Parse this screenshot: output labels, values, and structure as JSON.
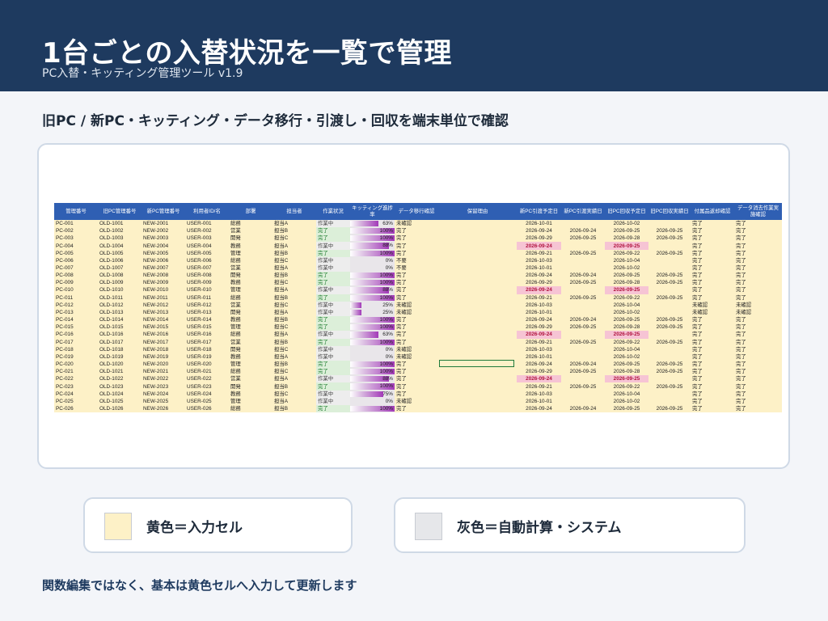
{
  "header": {
    "title": "1台ごとの入替状況を一覧で管理",
    "subtitle": "PC入替・キッティング管理ツール v1.9"
  },
  "section_title": "旧PC / 新PC・キッティング・データ移行・引渡し・回収を端末単位で確認",
  "colors": {
    "header_bg": "#1e3a5f",
    "grid_header": "#2f5fb3",
    "input_cell": "#fdf1c7",
    "auto_cell": "#e6e7ea",
    "overdue_cell": "#f6c4d4",
    "progress_bar": "#a23ab8"
  },
  "sheet": {
    "columns": [
      "管理番号",
      "旧PC管理番号",
      "新PC管理番号",
      "利用者ID/名",
      "部署",
      "担当者",
      "作業状況",
      "キッティング進捗率",
      "データ移行確認",
      "保留理由",
      "新PC引渡予定日",
      "新PC引渡実績日",
      "旧PC回収予定日",
      "旧PC回収実績日",
      "付属品返却確認",
      "データ消去作業実施確認"
    ],
    "rows": [
      {
        "id": "PC-001",
        "old": "OLD-1001",
        "new": "NEW-2001",
        "user": "USER-001",
        "dept": "総務",
        "owner": "担当A",
        "status": "作業中",
        "pct_label": "63%",
        "pct": 0.63,
        "migration": "未確認",
        "hold": "",
        "deliv_plan": "2026-10-01",
        "deliv_act": "",
        "coll_plan": "2026-10-02",
        "coll_act": "",
        "acc": "完了",
        "erase": "完了",
        "overdue": false
      },
      {
        "id": "PC-002",
        "old": "OLD-1002",
        "new": "NEW-2002",
        "user": "USER-002",
        "dept": "営業",
        "owner": "担当B",
        "status": "完了",
        "pct_label": "100%",
        "pct": 1.0,
        "migration": "完了",
        "hold": "",
        "deliv_plan": "2026-09-24",
        "deliv_act": "2026-09-24",
        "coll_plan": "2026-09-25",
        "coll_act": "2026-09-25",
        "acc": "完了",
        "erase": "完了",
        "overdue": false
      },
      {
        "id": "PC-003",
        "old": "OLD-1003",
        "new": "NEW-2003",
        "user": "USER-003",
        "dept": "開発",
        "owner": "担当C",
        "status": "完了",
        "pct_label": "100%",
        "pct": 1.0,
        "migration": "完了",
        "hold": "",
        "deliv_plan": "2026-09-29",
        "deliv_act": "2026-09-25",
        "coll_plan": "2026-09-28",
        "coll_act": "2026-09-25",
        "acc": "完了",
        "erase": "完了",
        "overdue": false
      },
      {
        "id": "PC-004",
        "old": "OLD-1004",
        "new": "NEW-2004",
        "user": "USER-004",
        "dept": "教務",
        "owner": "担当A",
        "status": "作業中",
        "pct_label": "88%",
        "pct": 0.88,
        "migration": "完了",
        "hold": "",
        "deliv_plan": "2026-09-24",
        "deliv_act": "",
        "coll_plan": "2026-09-25",
        "coll_act": "",
        "acc": "完了",
        "erase": "完了",
        "overdue": true
      },
      {
        "id": "PC-005",
        "old": "OLD-1005",
        "new": "NEW-2005",
        "user": "USER-005",
        "dept": "管理",
        "owner": "担当B",
        "status": "完了",
        "pct_label": "100%",
        "pct": 1.0,
        "migration": "完了",
        "hold": "",
        "deliv_plan": "2026-09-21",
        "deliv_act": "2026-09-25",
        "coll_plan": "2026-09-22",
        "coll_act": "2026-09-25",
        "acc": "完了",
        "erase": "完了",
        "overdue": false
      },
      {
        "id": "PC-006",
        "old": "OLD-1006",
        "new": "NEW-2006",
        "user": "USER-006",
        "dept": "総務",
        "owner": "担当C",
        "status": "作業中",
        "pct_label": "0%",
        "pct": 0.0,
        "migration": "不要",
        "hold": "",
        "deliv_plan": "2026-10-03",
        "deliv_act": "",
        "coll_plan": "2026-10-04",
        "coll_act": "",
        "acc": "完了",
        "erase": "完了",
        "overdue": false
      },
      {
        "id": "PC-007",
        "old": "OLD-1007",
        "new": "NEW-2007",
        "user": "USER-007",
        "dept": "営業",
        "owner": "担当A",
        "status": "作業中",
        "pct_label": "0%",
        "pct": 0.0,
        "migration": "不要",
        "hold": "",
        "deliv_plan": "2026-10-01",
        "deliv_act": "",
        "coll_plan": "2026-10-02",
        "coll_act": "",
        "acc": "完了",
        "erase": "完了",
        "overdue": false
      },
      {
        "id": "PC-008",
        "old": "OLD-1008",
        "new": "NEW-2008",
        "user": "USER-008",
        "dept": "開発",
        "owner": "担当B",
        "status": "完了",
        "pct_label": "100%",
        "pct": 1.0,
        "migration": "完了",
        "hold": "",
        "deliv_plan": "2026-09-24",
        "deliv_act": "2026-09-24",
        "coll_plan": "2026-09-25",
        "coll_act": "2026-09-25",
        "acc": "完了",
        "erase": "完了",
        "overdue": false
      },
      {
        "id": "PC-009",
        "old": "OLD-1009",
        "new": "NEW-2009",
        "user": "USER-009",
        "dept": "教務",
        "owner": "担当C",
        "status": "完了",
        "pct_label": "100%",
        "pct": 1.0,
        "migration": "完了",
        "hold": "",
        "deliv_plan": "2026-09-29",
        "deliv_act": "2026-09-25",
        "coll_plan": "2026-09-28",
        "coll_act": "2026-09-25",
        "acc": "完了",
        "erase": "完了",
        "overdue": false
      },
      {
        "id": "PC-010",
        "old": "OLD-1010",
        "new": "NEW-2010",
        "user": "USER-010",
        "dept": "管理",
        "owner": "担当A",
        "status": "作業中",
        "pct_label": "88%",
        "pct": 0.88,
        "migration": "完了",
        "hold": "",
        "deliv_plan": "2026-09-24",
        "deliv_act": "",
        "coll_plan": "2026-09-25",
        "coll_act": "",
        "acc": "完了",
        "erase": "完了",
        "overdue": true
      },
      {
        "id": "PC-011",
        "old": "OLD-1011",
        "new": "NEW-2011",
        "user": "USER-011",
        "dept": "総務",
        "owner": "担当B",
        "status": "完了",
        "pct_label": "100%",
        "pct": 1.0,
        "migration": "完了",
        "hold": "",
        "deliv_plan": "2026-09-21",
        "deliv_act": "2026-09-25",
        "coll_plan": "2026-09-22",
        "coll_act": "2026-09-25",
        "acc": "完了",
        "erase": "完了",
        "overdue": false
      },
      {
        "id": "PC-012",
        "old": "OLD-1012",
        "new": "NEW-2012",
        "user": "USER-012",
        "dept": "営業",
        "owner": "担当C",
        "status": "作業中",
        "pct_label": "25%",
        "pct": 0.25,
        "migration": "未確認",
        "hold": "",
        "deliv_plan": "2026-10-03",
        "deliv_act": "",
        "coll_plan": "2026-10-04",
        "coll_act": "",
        "acc": "未確認",
        "erase": "未確認",
        "overdue": false
      },
      {
        "id": "PC-013",
        "old": "OLD-1013",
        "new": "NEW-2013",
        "user": "USER-013",
        "dept": "開発",
        "owner": "担当A",
        "status": "作業中",
        "pct_label": "25%",
        "pct": 0.25,
        "migration": "未確認",
        "hold": "",
        "deliv_plan": "2026-10-01",
        "deliv_act": "",
        "coll_plan": "2026-10-02",
        "coll_act": "",
        "acc": "未確認",
        "erase": "未確認",
        "overdue": false
      },
      {
        "id": "PC-014",
        "old": "OLD-1014",
        "new": "NEW-2014",
        "user": "USER-014",
        "dept": "教務",
        "owner": "担当B",
        "status": "完了",
        "pct_label": "100%",
        "pct": 1.0,
        "migration": "完了",
        "hold": "",
        "deliv_plan": "2026-09-24",
        "deliv_act": "2026-09-24",
        "coll_plan": "2026-09-25",
        "coll_act": "2026-09-25",
        "acc": "完了",
        "erase": "完了",
        "overdue": false
      },
      {
        "id": "PC-015",
        "old": "OLD-1015",
        "new": "NEW-2015",
        "user": "USER-015",
        "dept": "管理",
        "owner": "担当C",
        "status": "完了",
        "pct_label": "100%",
        "pct": 1.0,
        "migration": "完了",
        "hold": "",
        "deliv_plan": "2026-09-29",
        "deliv_act": "2026-09-25",
        "coll_plan": "2026-09-28",
        "coll_act": "2026-09-25",
        "acc": "完了",
        "erase": "完了",
        "overdue": false
      },
      {
        "id": "PC-016",
        "old": "OLD-1016",
        "new": "NEW-2016",
        "user": "USER-016",
        "dept": "総務",
        "owner": "担当A",
        "status": "作業中",
        "pct_label": "63%",
        "pct": 0.63,
        "migration": "完了",
        "hold": "",
        "deliv_plan": "2026-09-24",
        "deliv_act": "",
        "coll_plan": "2026-09-25",
        "coll_act": "",
        "acc": "完了",
        "erase": "完了",
        "overdue": true
      },
      {
        "id": "PC-017",
        "old": "OLD-1017",
        "new": "NEW-2017",
        "user": "USER-017",
        "dept": "営業",
        "owner": "担当B",
        "status": "完了",
        "pct_label": "100%",
        "pct": 1.0,
        "migration": "完了",
        "hold": "",
        "deliv_plan": "2026-09-21",
        "deliv_act": "2026-09-25",
        "coll_plan": "2026-09-22",
        "coll_act": "2026-09-25",
        "acc": "完了",
        "erase": "完了",
        "overdue": false
      },
      {
        "id": "PC-018",
        "old": "OLD-1018",
        "new": "NEW-2018",
        "user": "USER-018",
        "dept": "開発",
        "owner": "担当C",
        "status": "作業中",
        "pct_label": "0%",
        "pct": 0.0,
        "migration": "未確認",
        "hold": "",
        "deliv_plan": "2026-10-03",
        "deliv_act": "",
        "coll_plan": "2026-10-04",
        "coll_act": "",
        "acc": "完了",
        "erase": "完了",
        "overdue": false
      },
      {
        "id": "PC-019",
        "old": "OLD-1019",
        "new": "NEW-2019",
        "user": "USER-019",
        "dept": "教務",
        "owner": "担当A",
        "status": "作業中",
        "pct_label": "0%",
        "pct": 0.0,
        "migration": "未確認",
        "hold": "",
        "deliv_plan": "2026-10-01",
        "deliv_act": "",
        "coll_plan": "2026-10-02",
        "coll_act": "",
        "acc": "完了",
        "erase": "完了",
        "overdue": false
      },
      {
        "id": "PC-020",
        "old": "OLD-1020",
        "new": "NEW-2020",
        "user": "USER-020",
        "dept": "管理",
        "owner": "担当B",
        "status": "完了",
        "pct_label": "100%",
        "pct": 1.0,
        "migration": "完了",
        "hold": "",
        "deliv_plan": "2026-09-24",
        "deliv_act": "2026-09-24",
        "coll_plan": "2026-09-25",
        "coll_act": "2026-09-25",
        "acc": "完了",
        "erase": "完了",
        "overdue": false
      },
      {
        "id": "PC-021",
        "old": "OLD-1021",
        "new": "NEW-2021",
        "user": "USER-021",
        "dept": "総務",
        "owner": "担当C",
        "status": "完了",
        "pct_label": "100%",
        "pct": 1.0,
        "migration": "完了",
        "hold": "",
        "deliv_plan": "2026-09-29",
        "deliv_act": "2026-09-25",
        "coll_plan": "2026-09-28",
        "coll_act": "2026-09-25",
        "acc": "完了",
        "erase": "完了",
        "overdue": false
      },
      {
        "id": "PC-022",
        "old": "OLD-1022",
        "new": "NEW-2022",
        "user": "USER-022",
        "dept": "営業",
        "owner": "担当A",
        "status": "作業中",
        "pct_label": "88%",
        "pct": 0.88,
        "migration": "完了",
        "hold": "",
        "deliv_plan": "2026-09-24",
        "deliv_act": "",
        "coll_plan": "2026-09-25",
        "coll_act": "",
        "acc": "完了",
        "erase": "完了",
        "overdue": true
      },
      {
        "id": "PC-023",
        "old": "OLD-1023",
        "new": "NEW-2023",
        "user": "USER-023",
        "dept": "開発",
        "owner": "担当B",
        "status": "完了",
        "pct_label": "100%",
        "pct": 1.0,
        "migration": "完了",
        "hold": "",
        "deliv_plan": "2026-09-21",
        "deliv_act": "2026-09-25",
        "coll_plan": "2026-09-22",
        "coll_act": "2026-09-25",
        "acc": "完了",
        "erase": "完了",
        "overdue": false
      },
      {
        "id": "PC-024",
        "old": "OLD-1024",
        "new": "NEW-2024",
        "user": "USER-024",
        "dept": "教務",
        "owner": "担当C",
        "status": "作業中",
        "pct_label": "75%",
        "pct": 0.75,
        "migration": "完了",
        "hold": "",
        "deliv_plan": "2026-10-03",
        "deliv_act": "",
        "coll_plan": "2026-10-04",
        "coll_act": "",
        "acc": "完了",
        "erase": "完了",
        "overdue": false
      },
      {
        "id": "PC-025",
        "old": "OLD-1025",
        "new": "NEW-2025",
        "user": "USER-025",
        "dept": "管理",
        "owner": "担当A",
        "status": "作業中",
        "pct_label": "0%",
        "pct": 0.0,
        "migration": "未確認",
        "hold": "",
        "deliv_plan": "2026-10-01",
        "deliv_act": "",
        "coll_plan": "2026-10-02",
        "coll_act": "",
        "acc": "完了",
        "erase": "完了",
        "overdue": false
      },
      {
        "id": "PC-026",
        "old": "OLD-1026",
        "new": "NEW-2026",
        "user": "USER-026",
        "dept": "総務",
        "owner": "担当B",
        "status": "完了",
        "pct_label": "100%",
        "pct": 1.0,
        "migration": "完了",
        "hold": "",
        "deliv_plan": "2026-09-24",
        "deliv_act": "2026-09-24",
        "coll_plan": "2026-09-25",
        "coll_act": "2026-09-25",
        "acc": "完了",
        "erase": "完了",
        "overdue": false
      }
    ]
  },
  "legend": {
    "input": {
      "label": "黄色＝入力セル",
      "color": "#fdf1c7"
    },
    "auto": {
      "label": "灰色＝自動計算・システム",
      "color": "#e6e7ea"
    }
  },
  "footer_note": "関数編集ではなく、基本は黄色セルへ入力して更新します"
}
